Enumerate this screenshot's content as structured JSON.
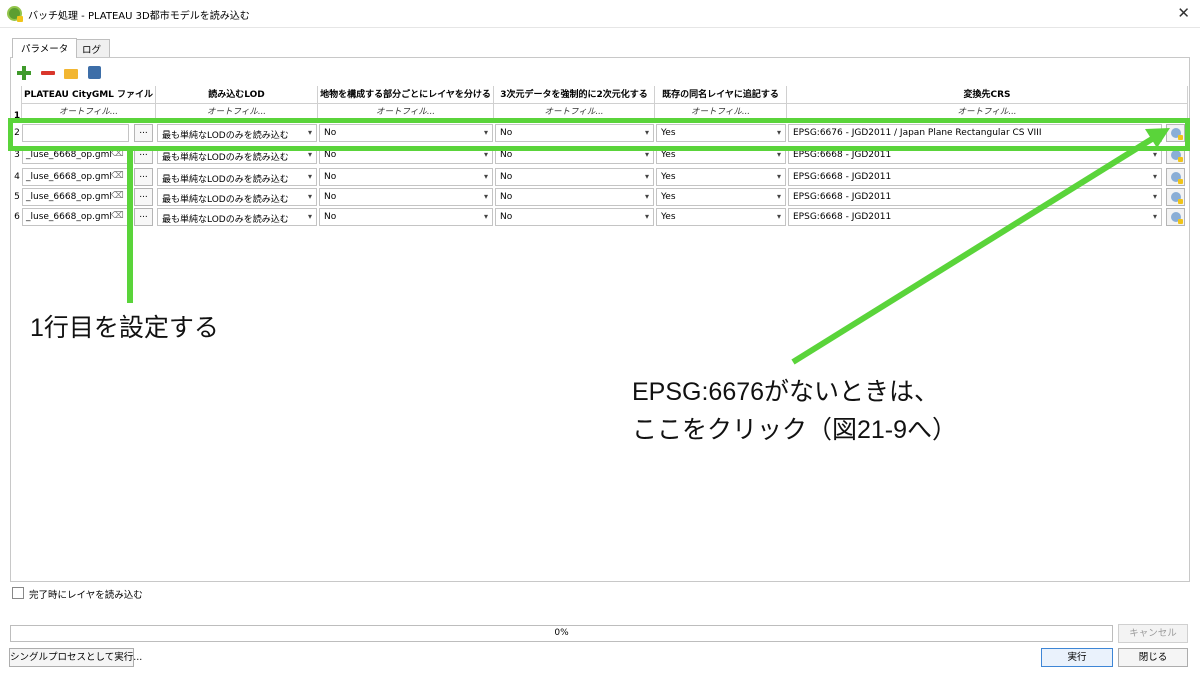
{
  "window": {
    "title": "バッチ処理 - PLATEAU 3D都市モデルを読み込む"
  },
  "tabs": [
    {
      "label": "パラメータ"
    },
    {
      "label": "ログ"
    }
  ],
  "toolbar": {
    "add_icon": "add-row-icon",
    "remove_icon": "remove-row-icon",
    "open_icon": "folder-open-icon",
    "save_icon": "save-icon"
  },
  "table": {
    "headers": [
      "PLATEAU CityGML ファイル",
      "読み込むLOD",
      "地物を構成する部分ごとにレイヤを分ける",
      "3次元データを強制的に2次元化する",
      "既存の同名レイヤに追記する",
      "変換先CRS"
    ],
    "autofill_label": "オートフィル...",
    "header_row_number": "1",
    "rows": [
      {
        "num": "2",
        "file": "",
        "lod": "最も単純なLODのみを読み込む",
        "split": "No",
        "force2d": "No",
        "append": "Yes",
        "crs": "EPSG:6676 - JGD2011 / Japan Plane Rectangular CS VIII"
      },
      {
        "num": "3",
        "file": "_luse_6668_op.gml",
        "lod": "最も単純なLODのみを読み込む",
        "split": "No",
        "force2d": "No",
        "append": "Yes",
        "crs": "EPSG:6668 - JGD2011"
      },
      {
        "num": "4",
        "file": "_luse_6668_op.gml",
        "lod": "最も単純なLODのみを読み込む",
        "split": "No",
        "force2d": "No",
        "append": "Yes",
        "crs": "EPSG:6668 - JGD2011"
      },
      {
        "num": "5",
        "file": "_luse_6668_op.gml",
        "lod": "最も単純なLODのみを読み込む",
        "split": "No",
        "force2d": "No",
        "append": "Yes",
        "crs": "EPSG:6668 - JGD2011"
      },
      {
        "num": "6",
        "file": "_luse_6668_op.gml",
        "lod": "最も単純なLODのみを読み込む",
        "split": "No",
        "force2d": "No",
        "append": "Yes",
        "crs": "EPSG:6668 - JGD2011"
      }
    ],
    "browse_label": "...",
    "clear_glyph": "⌫"
  },
  "annotations": {
    "row1": "1行目を設定する",
    "crs_line1": "EPSG:6676がないときは、",
    "crs_line2": "ここをクリック（図21-9へ）",
    "highlight_color": "#5ad43a"
  },
  "footer": {
    "load_layers_label": "完了時にレイヤを読み込む",
    "progress_text": "0%",
    "progress_value": 0,
    "cancel_label": "キャンセル",
    "single_process_label": "シングルプロセスとして実行...",
    "run_label": "実行",
    "close_label": "閉じる"
  }
}
